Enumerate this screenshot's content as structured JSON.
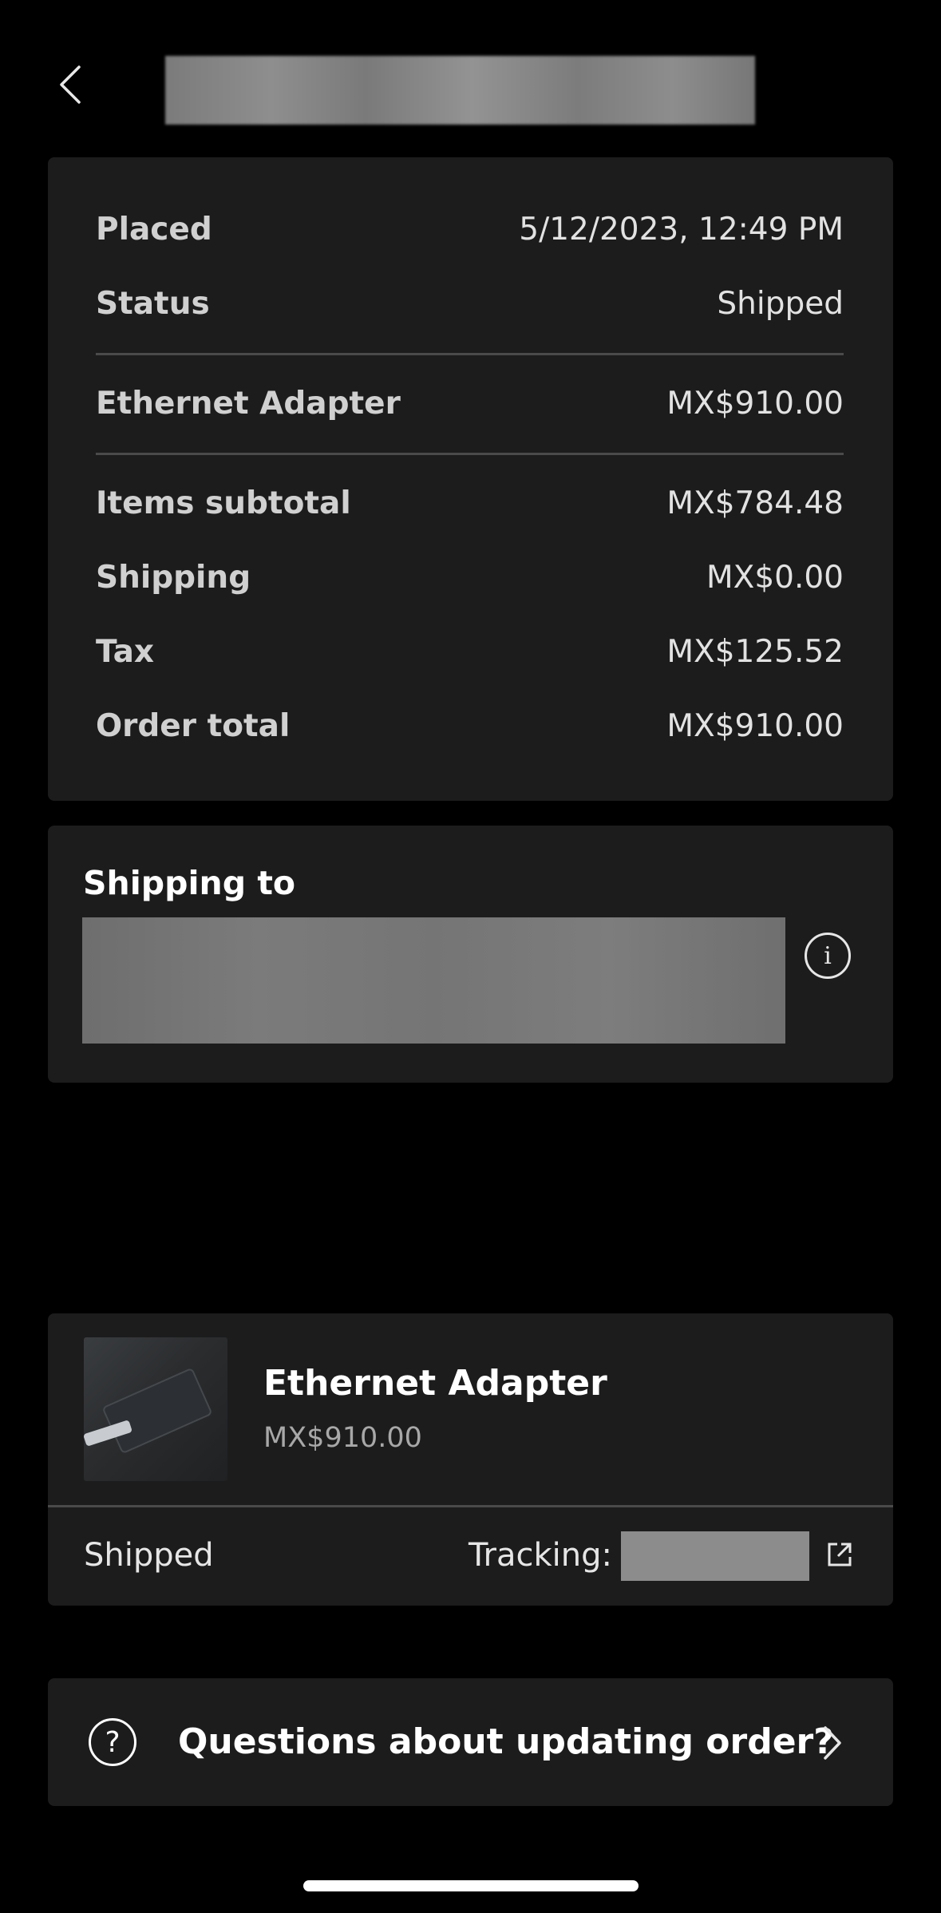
{
  "header": {
    "back_icon": "chevron-left-icon"
  },
  "summary": {
    "placed_label": "Placed",
    "placed_value": "5/12/2023, 12:49 PM",
    "status_label": "Status",
    "status_value": "Shipped",
    "product_label": "Ethernet Adapter",
    "product_value": "MX$910.00",
    "subtotal_label": "Items subtotal",
    "subtotal_value": "MX$784.48",
    "shipping_label": "Shipping",
    "shipping_value": "MX$0.00",
    "tax_label": "Tax",
    "tax_value": "MX$125.52",
    "total_label": "Order total",
    "total_value": "MX$910.00"
  },
  "shipping_to": {
    "title": "Shipping to",
    "info_icon": "info-icon"
  },
  "item": {
    "name": "Ethernet Adapter",
    "price": "MX$910.00",
    "status": "Shipped",
    "tracking_label": "Tracking:",
    "external_icon": "external-link-icon"
  },
  "help": {
    "icon": "question-circle-icon",
    "label": "Questions about updating order?",
    "chevron": "chevron-right-icon"
  }
}
